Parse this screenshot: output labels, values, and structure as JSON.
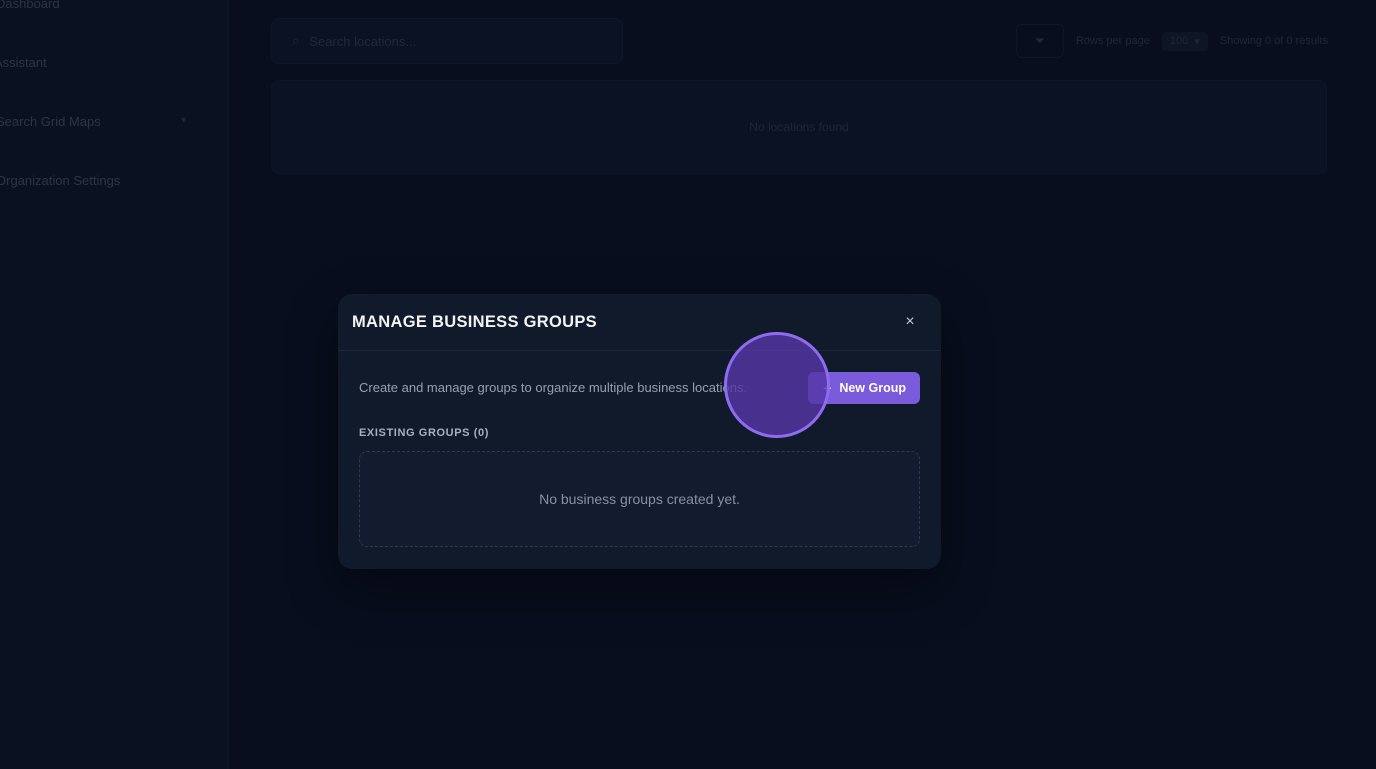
{
  "background": {
    "sidebar": {
      "items": [
        {
          "label": "Dashboard"
        },
        {
          "label": "Assistant"
        },
        {
          "label": "Search Grid Maps"
        },
        {
          "label": "Organization Settings"
        }
      ]
    },
    "search": {
      "placeholder": "Search locations..."
    },
    "toolbar": {
      "rows_per_page_label": "Rows per page",
      "rows_per_page_value": "100",
      "count_text": "Showing 0 of 0 results"
    },
    "empty_text": "No locations found"
  },
  "modal": {
    "title": "MANAGE BUSINESS GROUPS",
    "close_symbol": "×",
    "description": "Create and manage groups to organize multiple business locations.",
    "new_group_button": {
      "label": "New Group",
      "icon": "plus-icon"
    },
    "existing_groups_label": "EXISTING GROUPS (0)",
    "empty_message": "No business groups created yet."
  },
  "colors": {
    "accent": "#7a5bdc",
    "background": "#0a1122",
    "modal_bg": "#111a2b"
  }
}
